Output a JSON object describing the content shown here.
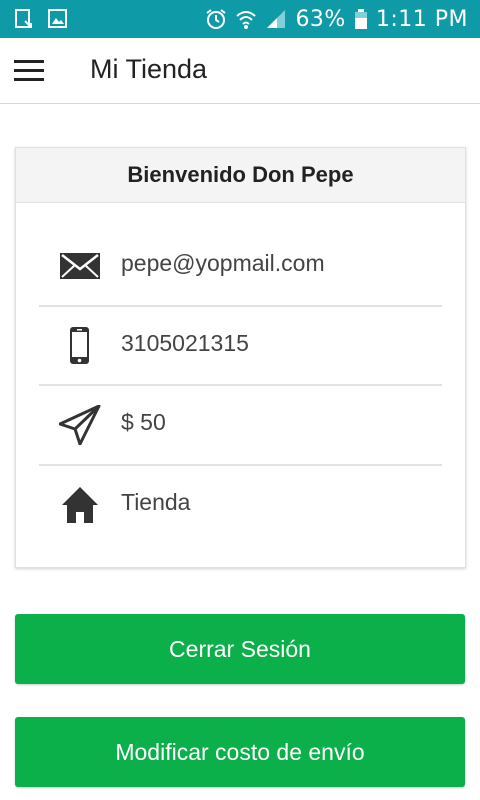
{
  "status_bar": {
    "battery": "63%",
    "time": "1:11 PM",
    "icons": [
      "download-icon",
      "image-icon",
      "alarm-icon",
      "wifi-icon",
      "signal-icon",
      "battery-icon"
    ]
  },
  "appbar": {
    "title": "Mi Tienda",
    "menu_icon": "hamburger-menu-icon"
  },
  "profile_card": {
    "header": "Bienvenido Don Pepe",
    "rows": [
      {
        "icon": "mail-icon",
        "value": "pepe@yopmail.com"
      },
      {
        "icon": "phone-icon",
        "value": "3105021315"
      },
      {
        "icon": "send-icon",
        "value": "$ 50"
      },
      {
        "icon": "home-icon",
        "value": "Tienda"
      }
    ]
  },
  "actions": {
    "logout_label": "Cerrar Sesión",
    "edit_shipping_label": "Modificar costo de envío"
  },
  "colors": {
    "status_bar": "#0f9aa8",
    "primary_button": "#0bb04a",
    "text": "#222222",
    "icon": "#333333"
  }
}
